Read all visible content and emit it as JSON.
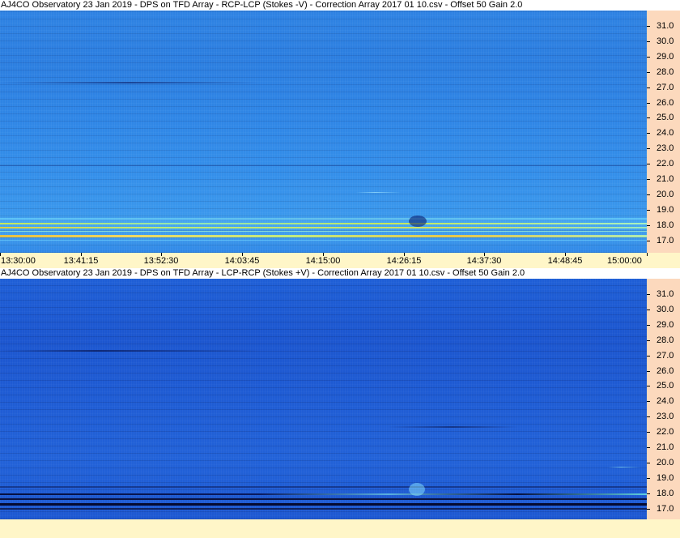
{
  "panels": [
    {
      "title": "AJ4CO Observatory 23 Jan 2019  -  DPS on TFD Array  -  RCP-LCP (Stokes -V)  -  Correction Array 2017 01 10.csv  -  Offset 50  Gain 2.0",
      "freq_labels": [
        "31.0",
        "30.0",
        "29.0",
        "28.0",
        "27.0",
        "26.0",
        "25.0",
        "24.0",
        "23.0",
        "22.0",
        "21.0",
        "20.0",
        "19.0",
        "18.0",
        "17.0"
      ]
    },
    {
      "title": "AJ4CO Observatory 23 Jan 2019  -  DPS on TFD Array  -  LCP-RCP (Stokes +V)  -  Correction Array 2017 01 10.csv  -  Offset 50  Gain 2.0",
      "freq_labels": [
        "31.0",
        "30.0",
        "29.0",
        "28.0",
        "27.0",
        "26.0",
        "25.0",
        "24.0",
        "23.0",
        "22.0",
        "21.0",
        "20.0",
        "19.0",
        "18.0",
        "17.0"
      ]
    }
  ],
  "time_axis": {
    "labels": [
      "13:30:00",
      "13:41:15",
      "13:52:30",
      "14:03:45",
      "14:15:00",
      "14:26:15",
      "14:37:30",
      "14:48:45",
      "15:00:00"
    ]
  },
  "colors": {
    "axis_bg": "#fcd9bd",
    "time_axis_bg": "#fff6c8",
    "top_panel_base": "#2f86e6",
    "bottom_panel_base": "#1f5cd4"
  }
}
